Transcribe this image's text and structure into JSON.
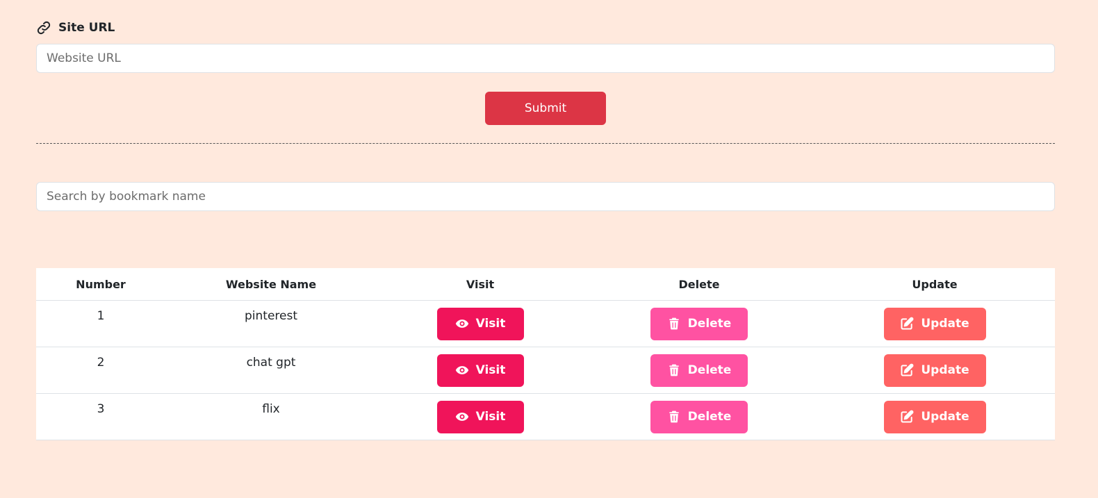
{
  "form": {
    "label": "Site URL",
    "label_icon": "link-icon",
    "url_placeholder": "Website URL",
    "submit_label": "Submit"
  },
  "search": {
    "placeholder": "Search by bookmark name"
  },
  "table": {
    "headers": [
      "Number",
      "Website Name",
      "Visit",
      "Delete",
      "Update"
    ],
    "rows": [
      {
        "number": "1",
        "name": "pinterest",
        "visit": "Visit",
        "delete": "Delete",
        "update": "Update"
      },
      {
        "number": "2",
        "name": "chat gpt",
        "visit": "Visit",
        "delete": "Delete",
        "update": "Update"
      },
      {
        "number": "3",
        "name": "flix",
        "visit": "Visit",
        "delete": "Delete",
        "update": "Update"
      }
    ]
  },
  "icons": {
    "visit": "eye-icon",
    "delete": "trash-icon",
    "update": "edit-icon"
  },
  "colors": {
    "background": "#ffe9dd",
    "submit": "#dc3545",
    "visit": "#f0145a",
    "delete": "#ff52a2",
    "update": "#ff6363"
  }
}
